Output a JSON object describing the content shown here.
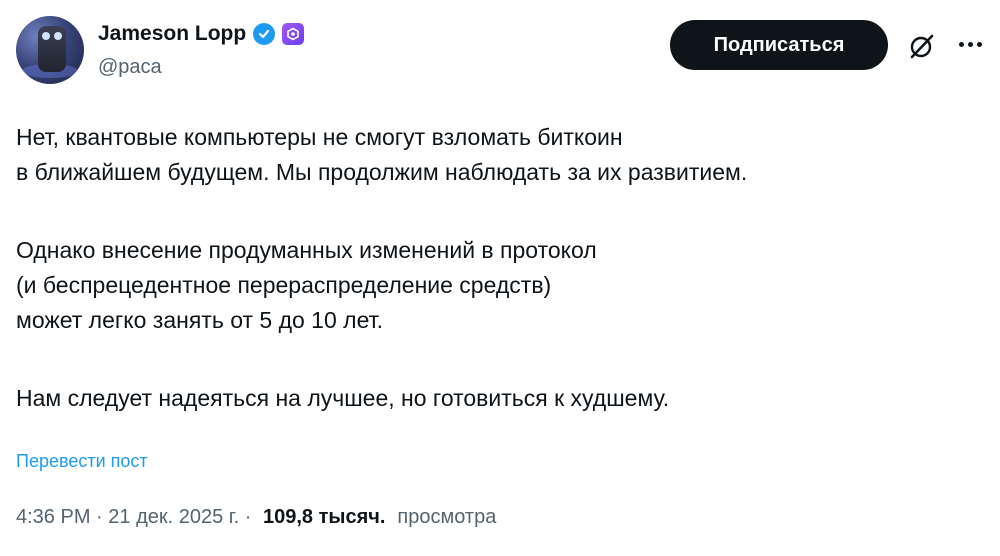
{
  "author": {
    "display_name": "Jameson Lopp",
    "handle": "@paca"
  },
  "actions": {
    "follow_label": "Подписаться"
  },
  "tweet": {
    "paragraphs": [
      [
        "Нет, квантовые компьютеры не смогут взломать биткоин",
        "в ближайшем будущем. Мы продолжим наблюдать за их развитием."
      ],
      [
        "Однако внесение продуманных изменений в протокол",
        "(и беспрецедентное перераспределение средств)",
        "может легко занять от 5 до 10 лет."
      ],
      [
        "Нам следует надеяться на лучшее, но готовиться к худшему."
      ]
    ],
    "translate_label": "Перевести пост"
  },
  "meta": {
    "time": "4:36 PM",
    "separator": " · ",
    "date": "21 дек. 2025 г.",
    "views_count": "109,8 тысяч.",
    "views_label": "просмотра"
  },
  "colors": {
    "text": "#0f1419",
    "secondary": "#536471",
    "link": "#1d9bf0",
    "button": "#0f1419"
  },
  "icons": [
    "verified-badge-icon",
    "affiliate-badge-icon",
    "grok-icon",
    "more-options-icon"
  ]
}
